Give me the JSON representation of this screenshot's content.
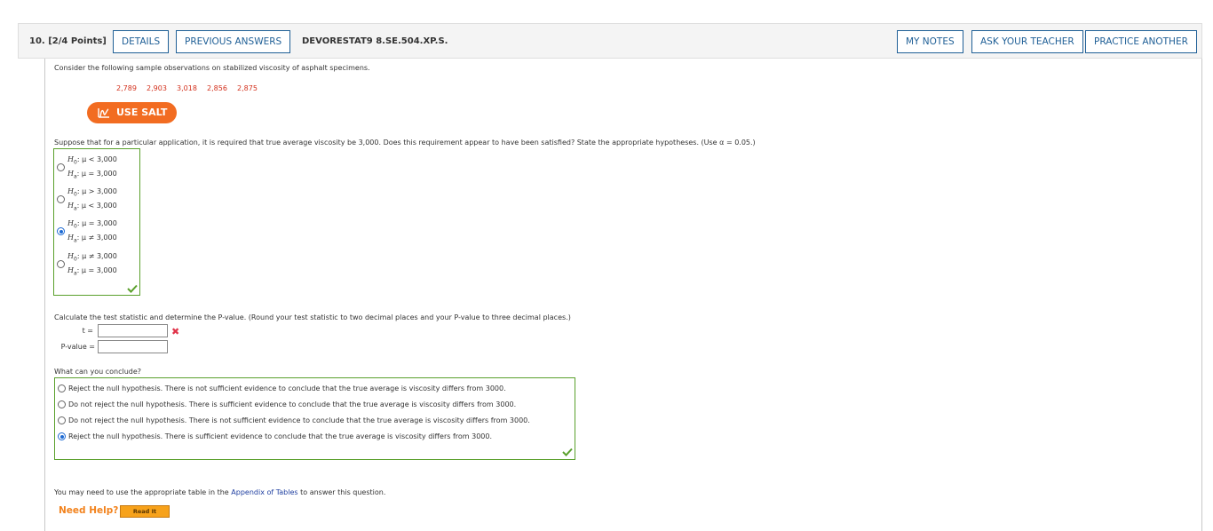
{
  "header": {
    "question_number": "10.",
    "points": "[2/4 Points]",
    "details_label": "DETAILS",
    "previous_answers_label": "PREVIOUS ANSWERS",
    "problem_code": "DEVORESTAT9 8.SE.504.XP.S.",
    "my_notes_label": "MY NOTES",
    "ask_teacher_label": "ASK YOUR TEACHER",
    "practice_another_label": "PRACTICE ANOTHER"
  },
  "intro": "Consider the following sample observations on stabilized viscosity of asphalt specimens.",
  "observations": [
    "2,789",
    "2,903",
    "3,018",
    "2,856",
    "2,875"
  ],
  "salt_label": "USE SALT",
  "hypothesis_prompt": "Suppose that for a particular application, it is required that true average viscosity be 3,000. Does this requirement appear to have been satisfied? State the appropriate hypotheses. (Use α = 0.05.)",
  "hypothesis_options": [
    {
      "h0": "μ < 3,000",
      "ha": "μ = 3,000",
      "selected": false
    },
    {
      "h0": "μ > 3,000",
      "ha": "μ < 3,000",
      "selected": false
    },
    {
      "h0": "μ = 3,000",
      "ha": "μ ≠ 3,000",
      "selected": true
    },
    {
      "h0": "μ ≠ 3,000",
      "ha": "μ = 3,000",
      "selected": false
    }
  ],
  "h0_symbol": "H",
  "h0_sub": "0",
  "ha_symbol": "H",
  "ha_sub": "a",
  "calc_prompt": "Calculate the test statistic and determine the P-value. (Round your test statistic to two decimal places and your P-value to three decimal places.)",
  "t_label": "t =",
  "t_value": "",
  "pvalue_label": "P-value =",
  "pvalue_value": "",
  "conclude_prompt": "What can you conclude?",
  "conclusion_options": [
    {
      "text": "Reject the null hypothesis. There is not sufficient evidence to conclude that the true average is viscosity differs from 3000.",
      "selected": false
    },
    {
      "text": "Do not reject the null hypothesis. There is sufficient evidence to conclude that the true average is viscosity differs from 3000.",
      "selected": false
    },
    {
      "text": "Do not reject the null hypothesis. There is not sufficient evidence to conclude that the true average is viscosity differs from 3000.",
      "selected": false
    },
    {
      "text": "Reject the null hypothesis. There is sufficient evidence to conclude that the true average is viscosity differs from 3000.",
      "selected": true
    }
  ],
  "appendix_prefix": "You may need to use the appropriate table in the",
  "appendix_link": "Appendix of Tables",
  "appendix_suffix": "to answer this question.",
  "need_help_label": "Need Help?",
  "read_it_label": "Read It",
  "colors": {
    "accent_blue": "#1f5f96",
    "salt_orange": "#f26c21",
    "observation_red": "#d3301c",
    "correct_green": "#5aa02c",
    "incorrect_red": "#e0344a"
  }
}
